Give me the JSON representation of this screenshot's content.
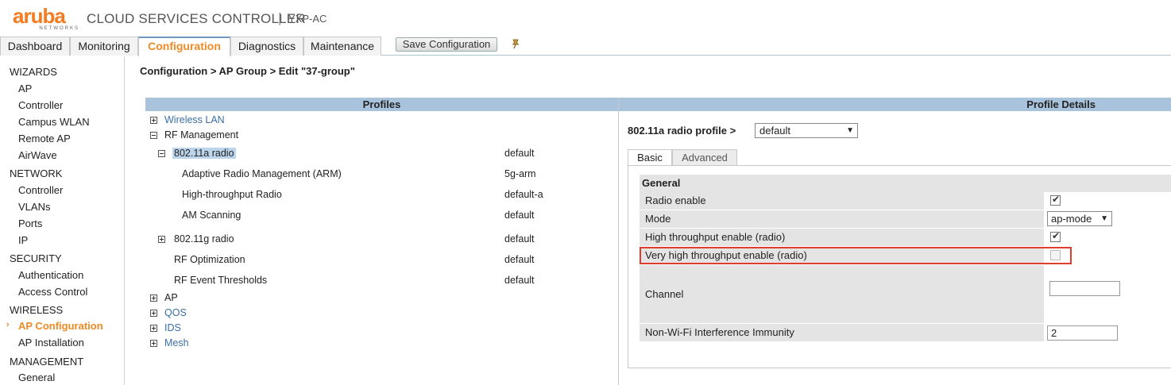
{
  "header": {
    "logo_text": "aruba",
    "logo_sub": "NETWORKS",
    "app_title": "CLOUD SERVICES CONTROLLER",
    "separator": "|",
    "host": "YXP-AC",
    "brand_color": "#f47b20"
  },
  "tabs": [
    {
      "label": "Dashboard",
      "active": false
    },
    {
      "label": "Monitoring",
      "active": false
    },
    {
      "label": "Configuration",
      "active": true
    },
    {
      "label": "Diagnostics",
      "active": false
    },
    {
      "label": "Maintenance",
      "active": false
    }
  ],
  "toolbar": {
    "save_label": "Save Configuration",
    "pin_icon": "pin-icon"
  },
  "sidebar": {
    "wizards": {
      "title": "WIZARDS",
      "items": [
        "AP",
        "Controller",
        "Campus WLAN",
        "Remote AP",
        "AirWave"
      ]
    },
    "network": {
      "title": "NETWORK",
      "items": [
        "Controller",
        "VLANs",
        "Ports",
        "IP"
      ]
    },
    "security": {
      "title": "SECURITY",
      "items": [
        "Authentication",
        "Access Control"
      ]
    },
    "wireless": {
      "title": "WIRELESS",
      "items": [
        "AP Configuration",
        "AP Installation"
      ],
      "active_index": 0,
      "active_marker": "›"
    },
    "management": {
      "title": "MANAGEMENT",
      "items": [
        "General"
      ]
    }
  },
  "breadcrumb": "Configuration > AP Group > Edit \"37-group\"",
  "profiles": {
    "header": "Profiles",
    "tree": [
      {
        "label": "Wireless LAN",
        "toggle": "plus",
        "value": ""
      },
      {
        "label": "RF Management",
        "toggle": "minus",
        "value": ""
      },
      {
        "label": "802.11a radio",
        "toggle": "minus",
        "value": "default"
      },
      {
        "label": "Adaptive Radio Management (ARM)",
        "toggle": "",
        "value": "5g-arm"
      },
      {
        "label": "High-throughput Radio",
        "toggle": "",
        "value": "default-a"
      },
      {
        "label": "AM Scanning",
        "toggle": "",
        "value": "default"
      },
      {
        "label": "802.11g radio",
        "toggle": "plus",
        "value": "default"
      },
      {
        "label": "RF Optimization",
        "toggle": "",
        "value": "default"
      },
      {
        "label": "RF Event Thresholds",
        "toggle": "",
        "value": "default"
      },
      {
        "label": "AP",
        "toggle": "plus",
        "value": ""
      },
      {
        "label": "QOS",
        "toggle": "plus",
        "value": ""
      },
      {
        "label": "IDS",
        "toggle": "plus",
        "value": ""
      },
      {
        "label": "Mesh",
        "toggle": "plus",
        "value": ""
      }
    ]
  },
  "details": {
    "header": "Profile Details",
    "profile_label": "802.11a radio profile >",
    "profile_value": "default",
    "tabs": [
      "Basic",
      "Advanced"
    ],
    "active_tab": "Basic",
    "section": "General",
    "fields": [
      {
        "label": "Radio enable",
        "type": "checkbox",
        "checked": true
      },
      {
        "label": "Mode",
        "type": "select",
        "value": "ap-mode"
      },
      {
        "label": "High throughput enable (radio)",
        "type": "checkbox",
        "checked": true
      },
      {
        "label": "Very high throughput enable (radio)",
        "type": "checkbox",
        "checked": false
      },
      {
        "label": "Channel",
        "type": "text",
        "value": ""
      },
      {
        "label": "Non-Wi-Fi Interference Immunity",
        "type": "text",
        "value": "2"
      }
    ],
    "highlight_color": "#e03c31"
  }
}
